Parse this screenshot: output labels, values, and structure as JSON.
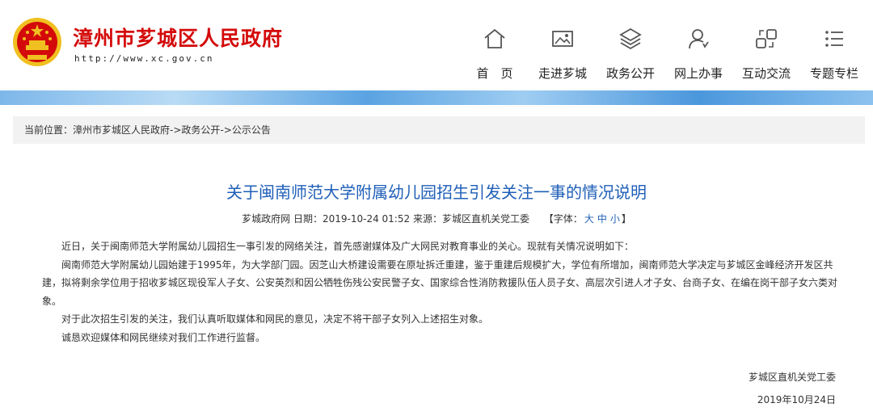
{
  "header": {
    "site_title": "漳州市芗城区人民政府",
    "site_url": "http://www.xc.gov.cn",
    "emblem_color": "#d40a0a",
    "nav": [
      {
        "label": "首　页",
        "icon": "home-icon"
      },
      {
        "label": "走进芗城",
        "icon": "image-gallery-icon"
      },
      {
        "label": "政务公开",
        "icon": "layers-icon"
      },
      {
        "label": "网上办事",
        "icon": "user-service-icon"
      },
      {
        "label": "互动交流",
        "icon": "interaction-icon"
      },
      {
        "label": "专题专栏",
        "icon": "list-icon"
      }
    ]
  },
  "breadcrumb": {
    "prefix": "当前位置：",
    "items": [
      "漳州市芗城区人民政府",
      "政务公开",
      "公示公告"
    ],
    "separator": "->"
  },
  "article": {
    "title": "关于闽南师范大学附属幼儿园招生引发关注一事的情况说明",
    "meta": {
      "source_site": "芗城政府网",
      "date_label": "日期：",
      "date": "2019-10-24 01:52",
      "origin_label": "来源：",
      "origin": "芗城区直机关党工委",
      "font_label_open": "【字体：",
      "font_large": "大",
      "font_medium": "中",
      "font_small": "小",
      "font_label_close": "】"
    },
    "paragraphs": [
      "近日，关于闽南师范大学附属幼儿园招生一事引发的网络关注，首先感谢媒体及广大网民对教育事业的关心。现就有关情况说明如下：",
      "闽南师范大学附属幼儿园始建于1995年，为大学部门园。因芝山大桥建设需要在原址拆迁重建，鉴于重建后规模扩大，学位有所增加，闽南师范大学决定与芗城区金峰经济开发区共建，拟将剩余学位用于招收芗城区现役军人子女、公安英烈和因公牺牲伤残公安民警子女、国家综合性消防救援队伍人员子女、高层次引进人才子女、台商子女、在编在岗干部子女六类对象。",
      "对于此次招生引发的关注，我们认真听取媒体和网民的意见，决定不将干部子女列入上述招生对象。",
      "诚恳欢迎媒体和网民继续对我们工作进行监督。"
    ],
    "signature": "芗城区直机关党工委",
    "sign_date": "2019年10月24日"
  },
  "colors": {
    "title_red": "#d40a0a",
    "article_title_blue": "#1f5fb8",
    "strip_blue": "#5aa3e2"
  }
}
